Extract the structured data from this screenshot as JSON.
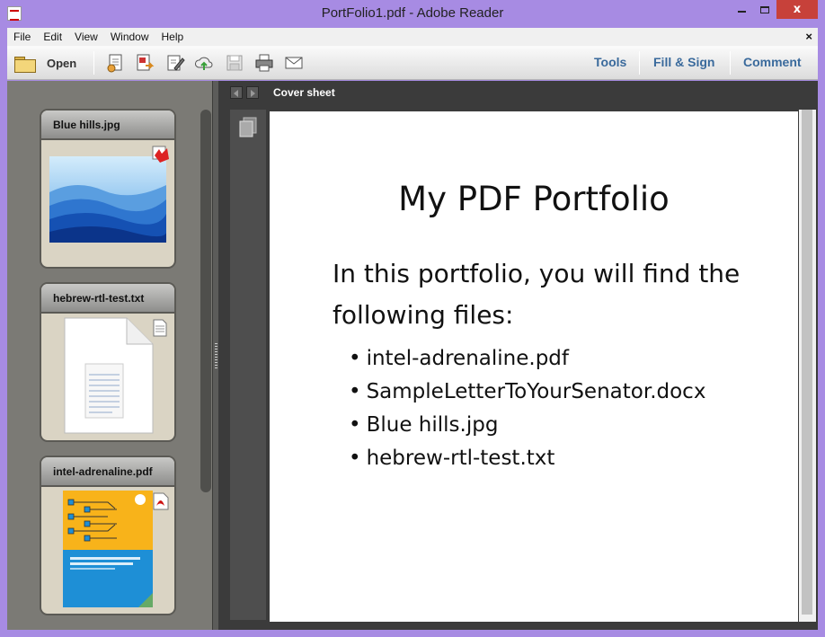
{
  "window": {
    "title": "PortFolio1.pdf - Adobe Reader",
    "close_glyph": "x"
  },
  "menu": {
    "items": [
      "File",
      "Edit",
      "View",
      "Window",
      "Help"
    ],
    "close_glyph": "×"
  },
  "toolbar": {
    "open_label": "Open",
    "icons": [
      "create-pdf-icon",
      "export-pdf-icon",
      "edit-pdf-icon",
      "upload-cloud-icon",
      "save-icon",
      "print-icon",
      "email-icon"
    ],
    "links": [
      "Tools",
      "Fill & Sign",
      "Comment"
    ]
  },
  "portfolio": {
    "files": [
      {
        "name": "Blue hills.jpg",
        "badge": "image-badge-icon"
      },
      {
        "name": "hebrew-rtl-test.txt",
        "badge": "text-file-badge-icon"
      },
      {
        "name": "intel-adrenaline.pdf",
        "badge": "pdf-badge-icon"
      }
    ]
  },
  "document": {
    "nav_title": "Cover sheet",
    "title": "My PDF Portfolio",
    "intro": "In this portfolio, you will find the following files:",
    "list": [
      "intel-adrenaline.pdf",
      "SampleLetterToYourSenator.docx",
      "Blue hills.jpg",
      "hebrew-rtl-test.txt"
    ]
  },
  "colors": {
    "frame": "#a78be3",
    "close_button": "#c7413a",
    "link_blue": "#3a6a9c",
    "pane_dark": "#3b3b3b",
    "left_pane": "#7b7a75"
  }
}
